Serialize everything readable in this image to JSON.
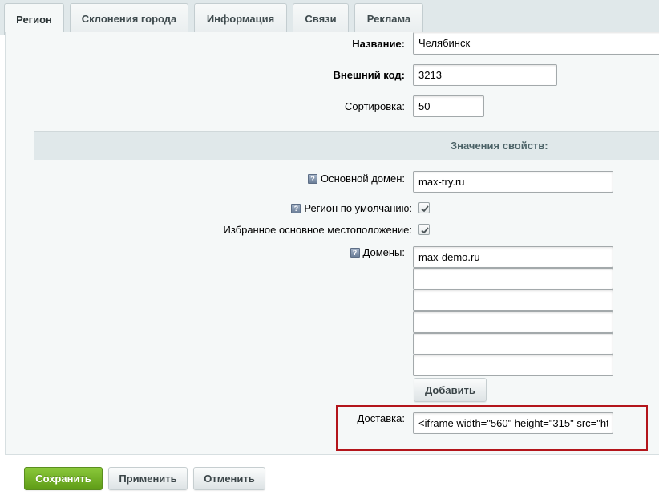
{
  "tabs": [
    {
      "label": "Регион",
      "active": true
    },
    {
      "label": "Склонения города",
      "active": false
    },
    {
      "label": "Информация",
      "active": false
    },
    {
      "label": "Связи",
      "active": false
    },
    {
      "label": "Реклама",
      "active": false
    }
  ],
  "form": {
    "name": {
      "label": "Название:",
      "value": "Челябинск"
    },
    "external_code": {
      "label": "Внешний код:",
      "value": "3213"
    },
    "sort": {
      "label": "Сортировка:",
      "value": "50"
    }
  },
  "properties": {
    "section_title": "Значения свойств:",
    "help_icon_glyph": "?",
    "main_domain": {
      "label": "Основной домен:",
      "value": "max-try.ru"
    },
    "default_region": {
      "label": "Регион по умолчанию:",
      "checked": true
    },
    "favorite_location": {
      "label": "Избранное основное местоположение:",
      "checked": true
    },
    "domains": {
      "label": "Домены:",
      "values": [
        "max-demo.ru",
        "",
        "",
        "",
        "",
        ""
      ],
      "add_label": "Добавить"
    },
    "delivery": {
      "label": "Доставка:",
      "value": "<iframe width=\"560\" height=\"315\" src=\"ht"
    }
  },
  "footer": {
    "save_label": "Сохранить",
    "apply_label": "Применить",
    "cancel_label": "Отменить"
  },
  "colors": {
    "accent_green": "#6fb125",
    "highlight_red": "#b3151b",
    "tab_bar": "#e0e8ea",
    "panel": "#f5f8f8"
  }
}
